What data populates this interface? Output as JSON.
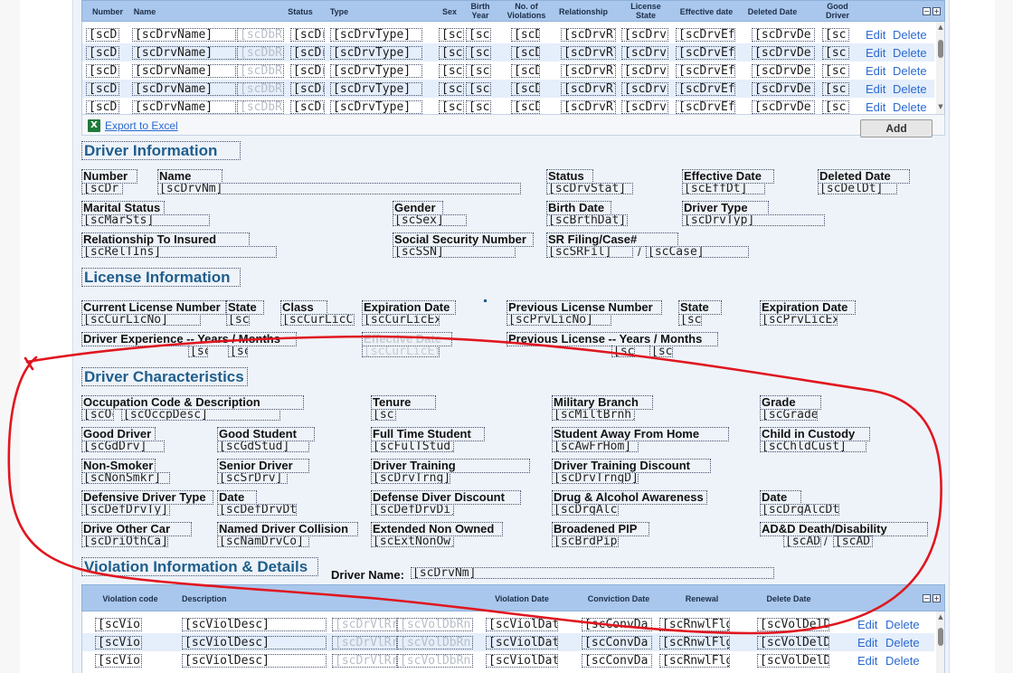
{
  "drivers_grid": {
    "headers": [
      "Number",
      "Name",
      "Status",
      "Type",
      "Sex",
      "Birth\nYear",
      "No. of\nViolations",
      "Relationship",
      "License\nState",
      "Effective date",
      "Deleted Date",
      "Good\nDriver"
    ],
    "row_values": [
      "[scD",
      "[scDrvName]",
      "[scDbR",
      "[scDr",
      "[scDrvType]",
      "[scD",
      "[scD",
      "[scD",
      "[scDrvRl",
      "[scDrvl",
      "[scDrvEff",
      "[scDrvDe",
      "[sc("
    ],
    "edit_label": "Edit",
    "delete_label": "Delete",
    "export_label": "Export to Excel",
    "add_label": "Add",
    "collapse_label": "−",
    "expand_label": "+"
  },
  "driver_info": {
    "title": "Driver Information",
    "fields": [
      {
        "label": "Number",
        "value": "[scDr"
      },
      {
        "label": "Name",
        "value": "[scDrvNm]"
      },
      {
        "label": "Status",
        "value": "[scDrvStat]"
      },
      {
        "label": "Effective Date",
        "value": "[scEffDt]"
      },
      {
        "label": "Deleted Date",
        "value": "[scDelDt]"
      },
      {
        "label": "Marital Status",
        "value": "[scMarSts]"
      },
      {
        "label": "Gender",
        "value": "[scSex]"
      },
      {
        "label": "Birth Date",
        "value": "[scBrthDat]"
      },
      {
        "label": "Driver Type",
        "value": "[scDrvTyp]"
      },
      {
        "label": "Relationship To Insured",
        "value": "[scRelTIns]"
      },
      {
        "label": "Social Security Number",
        "value": "[scSSN]"
      },
      {
        "label": "SR Filing/Case#",
        "value": "[scSRFil]",
        "value2": "[scCase]",
        "separator": "/"
      }
    ]
  },
  "license_info": {
    "title": "License Information",
    "fields": [
      {
        "label": "Current License Number",
        "value": "[scCurLicNo]"
      },
      {
        "label": "State",
        "value": "[sc("
      },
      {
        "label": "Class",
        "value": "[scCurLicCl"
      },
      {
        "label": "Expiration Date",
        "value": "[scCurLicEx"
      },
      {
        "label": "Previous License Number",
        "value": "[scPrvLicNo]"
      },
      {
        "label": "State",
        "value": "[scl"
      },
      {
        "label": "Expiration Date",
        "value": "[scPrvLicEx]"
      },
      {
        "label": "Driver Experience --  Years / Months",
        "value": "[sc[",
        "value2": "[sc["
      },
      {
        "label": "Effective Date",
        "value": "[scCurLicEf]"
      },
      {
        "label": "Previous License --  Years / Months",
        "value": "[sc[",
        "value2": "[sc["
      }
    ]
  },
  "driver_characteristics": {
    "title": "Driver Characteristics",
    "fields": [
      {
        "label": "Occupation Code & Description",
        "value": "[scOc",
        "value2": "[scOccpDesc]"
      },
      {
        "label": "Tenure",
        "value": "[sc]"
      },
      {
        "label": "Military Branch",
        "value": "[scMiltBrnh]"
      },
      {
        "label": "Grade",
        "value": "[scGrade"
      },
      {
        "label": "Good Driver",
        "value": "[scGdDrv]"
      },
      {
        "label": "Good Student",
        "value": "[scGdStud]"
      },
      {
        "label": "Full Time Student",
        "value": "[scFulTStud]"
      },
      {
        "label": "Student Away From Home",
        "value": "[scAwFrHom]"
      },
      {
        "label": "Child in Custody",
        "value": "[scChldCust]"
      },
      {
        "label": "Non-Smoker",
        "value": "[scNonSmkr]"
      },
      {
        "label": "Senior Driver",
        "value": "[scSrDrv]"
      },
      {
        "label": "Driver Training",
        "value": "[scDrvTrng]"
      },
      {
        "label": "Driver Training Discount",
        "value": "[scDrvTrngD]"
      },
      {
        "label": "Defensive Driver Type",
        "value": "[scDefDrvTy]"
      },
      {
        "label": "Date",
        "value": "[scDefDrvDt"
      },
      {
        "label": "Defense Diver Discount",
        "value": "[scDefDrvDi]"
      },
      {
        "label": "Drug & Alcohol Awareness",
        "value": "[scDrgAlc]"
      },
      {
        "label": "Date",
        "value": "[scDrgAlcDt"
      },
      {
        "label": "Drive Other Car",
        "value": "[scDriOthCa]"
      },
      {
        "label": "Named Driver Collision",
        "value": "[scNamDrvCo]"
      },
      {
        "label": "Extended Non Owned",
        "value": "[scExtNonOw]"
      },
      {
        "label": "Broadened PIP",
        "value": "[scBrdPip]"
      },
      {
        "label": "AD&D Death/Disability",
        "value": "[scAD",
        "value2": "[scAD",
        "separator": "/"
      }
    ]
  },
  "violation_info": {
    "title": "Violation Information & Details",
    "driver_name_label": "Driver Name:",
    "driver_name_value": "[scDrvNm]"
  },
  "violations_grid": {
    "headers": [
      "Violation code",
      "Description",
      "Violation Date",
      "Conviction Date",
      "Renewal",
      "Delete Date"
    ],
    "row_values": [
      "[scViol(",
      "[scViolDesc]",
      "[scDrVlRrn",
      "[scVolDbRn",
      "[scViolDate",
      "[scConvDa",
      "[scRnwlFlg",
      "[scVolDelD"
    ],
    "edit_label": "Edit",
    "delete_label": "Delete"
  },
  "colors": {
    "accent": "#1f5e8c",
    "annotation": "#e0161f",
    "grid_header": "#a9c7ec",
    "link": "#2a6ad1"
  }
}
